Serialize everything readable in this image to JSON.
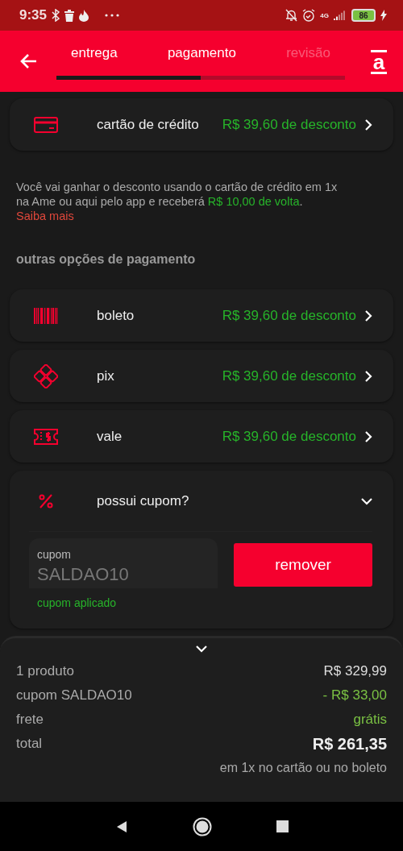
{
  "status_bar": {
    "time": "9:35",
    "network": "4G",
    "battery": "86"
  },
  "header": {
    "logo": "a",
    "progress": {
      "level": 0.5
    },
    "tabs": [
      {
        "label": "entrega",
        "disabled": false
      },
      {
        "label": "pagamento",
        "disabled": false
      },
      {
        "label": "revisão",
        "disabled": true
      }
    ]
  },
  "main_option": {
    "kind": "card",
    "label": "cartão de crédito",
    "discount": "R$ 39,60 de desconto"
  },
  "info": [
    {
      "kind": "plain",
      "text": "Você vai ganhar o desconto usando o cartão de crédito em 1x na Ame ou aqui pelo app e receberá "
    },
    {
      "kind": "highlight",
      "text": "R$ 10,00 de volta"
    },
    {
      "kind": "plain",
      "text": ". "
    },
    {
      "kind": "link",
      "text": "Saiba mais"
    }
  ],
  "section_title": "outras opções de pagamento",
  "options": [
    {
      "kind": "barcode",
      "label": "boleto",
      "discount": "R$ 39,60 de desconto"
    },
    {
      "kind": "pix",
      "label": "pix",
      "discount": "R$ 39,60 de desconto"
    },
    {
      "kind": "voucher",
      "label": "vale",
      "discount": "R$ 39,60 de desconto"
    }
  ],
  "coupon": {
    "label": "possui cupom?",
    "expanded": true,
    "field_label": "cupom",
    "value": "SALDAO10",
    "status": "cupom aplicado",
    "button": "remover"
  },
  "summary": [
    {
      "kind": "plain",
      "label": "1 produto",
      "value": "R$ 329,99"
    },
    {
      "kind": "discount",
      "label": "cupom SALDAO10",
      "value": "- R$ 33,00"
    },
    {
      "kind": "free",
      "label": "frete",
      "value": "grátis"
    },
    {
      "kind": "total",
      "label": "total",
      "value": "R$ 261,35"
    }
  ],
  "summary_note": "em 1x no cartão ou no boleto"
}
